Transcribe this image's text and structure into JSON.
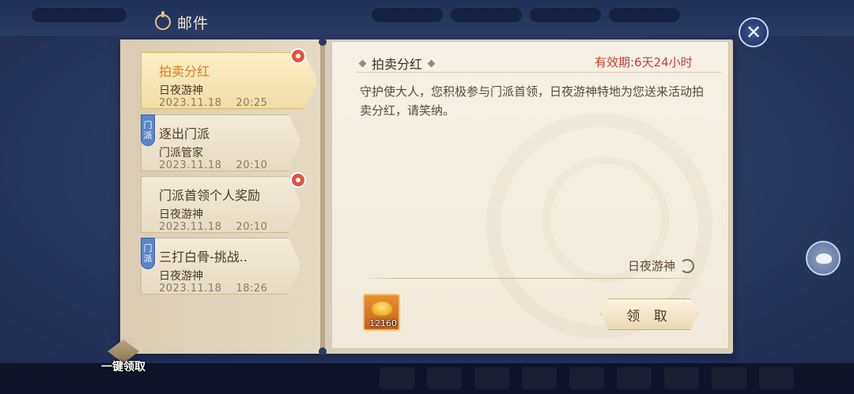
{
  "window": {
    "title": "邮件"
  },
  "mails": [
    {
      "title": "拍卖分红",
      "sender": "日夜游神",
      "date": "2023.11.18",
      "time": "20:25",
      "clan_tag": "",
      "unread_badge": true,
      "selected": true
    },
    {
      "title": "逐出门派",
      "sender": "门派管家",
      "date": "2023.11.18",
      "time": "20:10",
      "clan_tag": "门派",
      "unread_badge": false,
      "selected": false
    },
    {
      "title": "门派首领个人奖励",
      "sender": "日夜游神",
      "date": "2023.11.18",
      "time": "20:10",
      "clan_tag": "",
      "unread_badge": true,
      "selected": false
    },
    {
      "title": "三打白骨-挑战..",
      "sender": "日夜游神",
      "date": "2023.11.18",
      "time": "18:26",
      "clan_tag": "门派",
      "unread_badge": false,
      "selected": false
    }
  ],
  "detail": {
    "title": "拍卖分红",
    "expiry": "有效期:6天24小时",
    "body": "守护使大人，您积极参与门派首领，日夜游神特地为您送来活动拍卖分红，请笑纳。",
    "signature": "日夜游神",
    "reward": {
      "icon": "gold-ingot-icon",
      "count": "12160"
    },
    "claim_label": "领 取"
  },
  "claim_all_label": "一键领取",
  "colors": {
    "selected_title": "#e07a1f",
    "expiry": "#c8402e",
    "clan_tag": "#5b86c9",
    "badge": "#e6503b"
  }
}
